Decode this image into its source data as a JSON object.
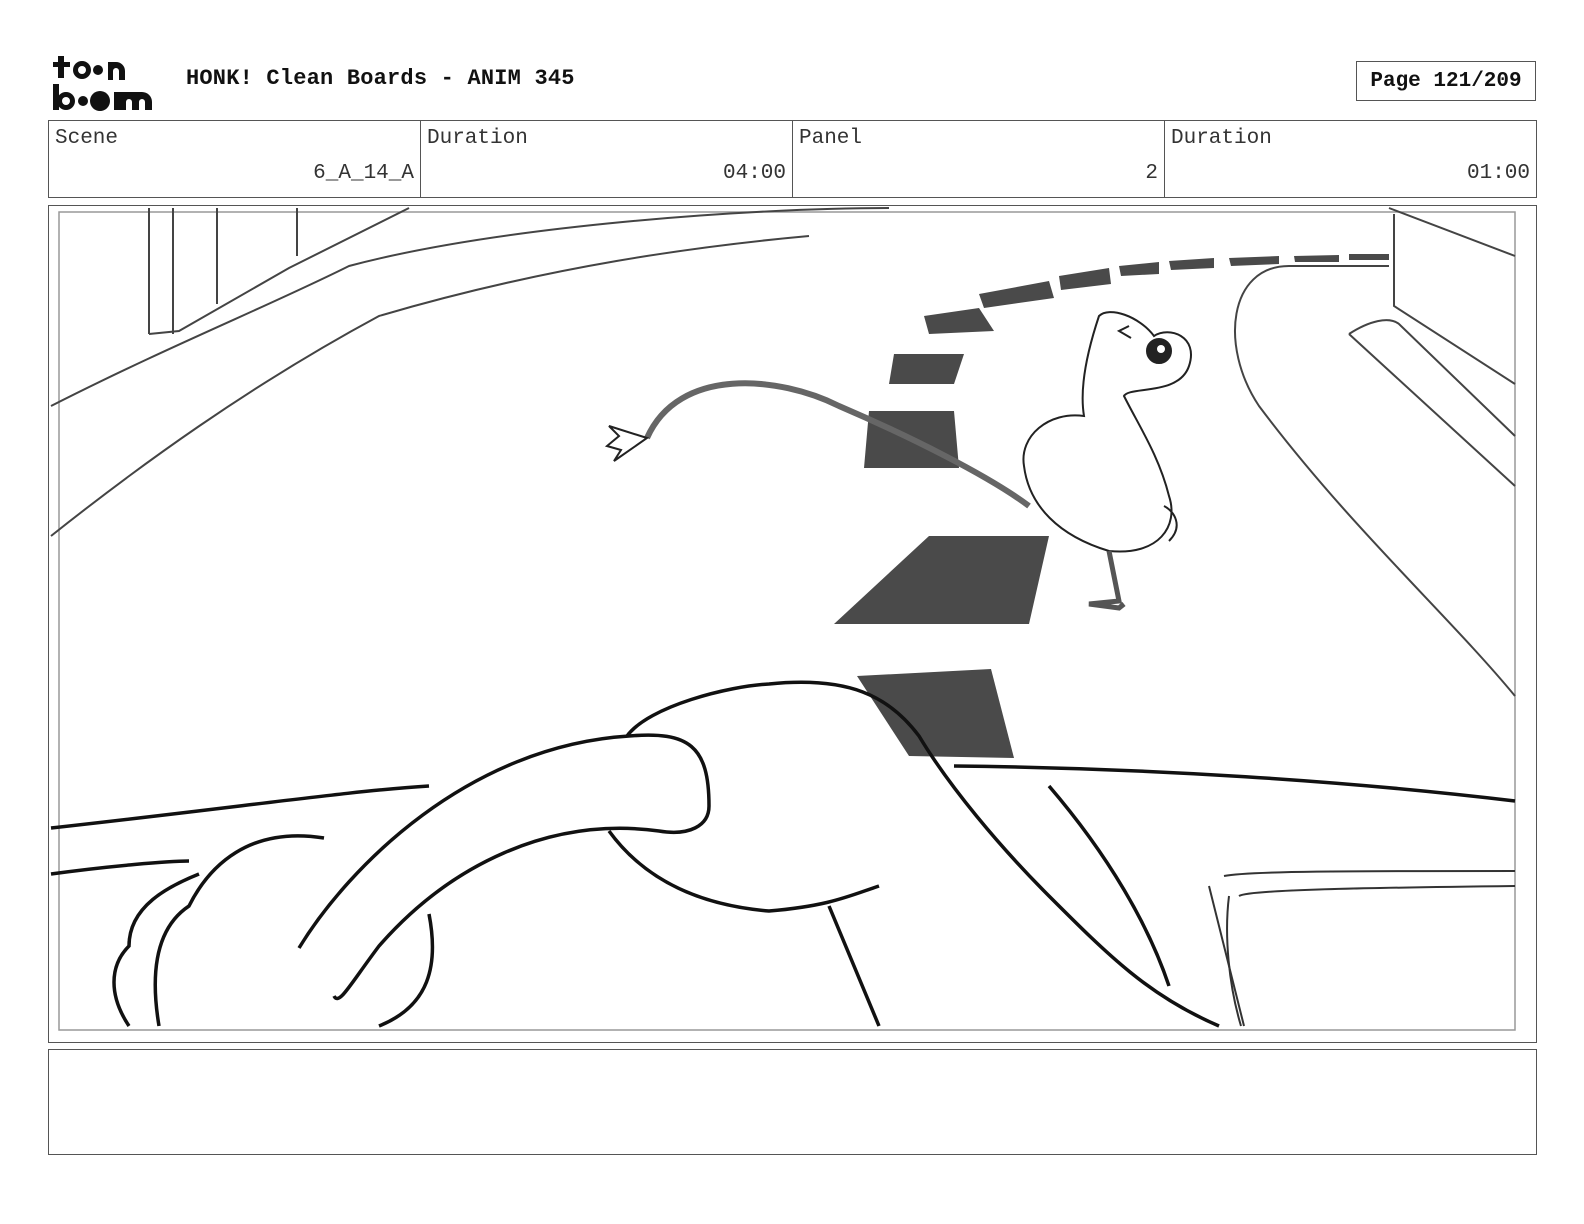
{
  "header": {
    "logo_text": "toon boom",
    "title": "HONK! Clean Boards - ANIM 345",
    "page_label": "Page 121/209"
  },
  "info": {
    "scene_label": "Scene",
    "scene_value": "6_A_14_A",
    "duration_label": "Duration",
    "duration_value": "04:00",
    "panel_label": "Panel",
    "panel_value": "2",
    "panel_duration_label": "Duration",
    "panel_duration_value": "01:00"
  },
  "notes": {
    "text": ""
  }
}
